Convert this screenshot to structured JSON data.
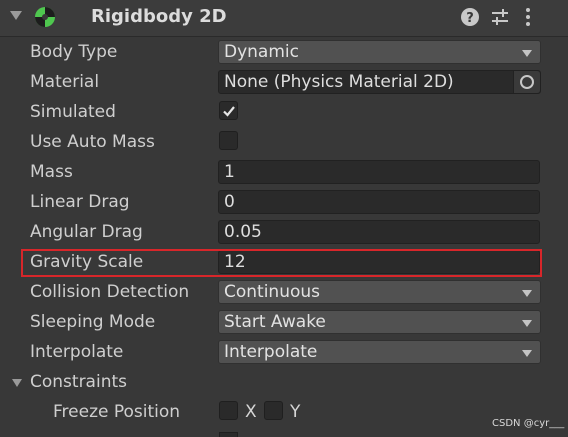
{
  "component": {
    "title": "Rigidbody 2D",
    "header_icons": [
      "help-icon",
      "presets-icon",
      "more-options-icon"
    ]
  },
  "properties": {
    "body_type": {
      "label": "Body Type",
      "value": "Dynamic"
    },
    "material": {
      "label": "Material",
      "value": "None (Physics Material 2D)"
    },
    "simulated": {
      "label": "Simulated",
      "checked": true
    },
    "use_auto_mass": {
      "label": "Use Auto Mass",
      "checked": false
    },
    "mass": {
      "label": "Mass",
      "value": "1"
    },
    "linear_drag": {
      "label": "Linear Drag",
      "value": "0"
    },
    "angular_drag": {
      "label": "Angular Drag",
      "value": "0.05"
    },
    "gravity_scale": {
      "label": "Gravity Scale",
      "value": "12"
    },
    "collision_detection": {
      "label": "Collision Detection",
      "value": "Continuous"
    },
    "sleeping_mode": {
      "label": "Sleeping Mode",
      "value": "Start Awake"
    },
    "interpolate": {
      "label": "Interpolate",
      "value": "Interpolate"
    }
  },
  "constraints": {
    "label": "Constraints",
    "freeze_position": {
      "label": "Freeze Position",
      "x_label": "X",
      "y_label": "Y",
      "x": false,
      "y": false
    }
  },
  "watermark": "CSDN @cyr___",
  "colors": {
    "background": "#383838",
    "field_bg": "#2a2a2a",
    "dropdown_bg": "#515151",
    "highlight_border": "#d8262a",
    "component_icon_green": "#4fc74f"
  }
}
